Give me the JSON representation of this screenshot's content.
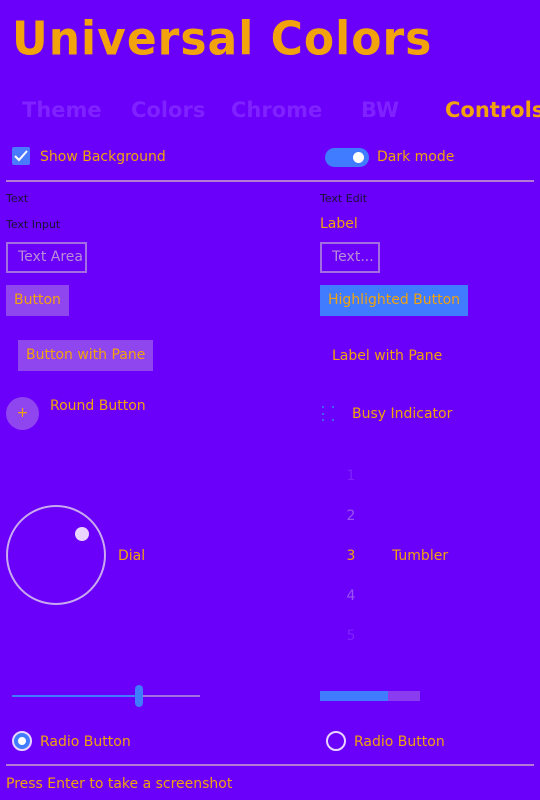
{
  "app": {
    "title": "Universal Colors"
  },
  "tabs": [
    {
      "label": "Theme",
      "active": false
    },
    {
      "label": "Colors",
      "active": false
    },
    {
      "label": "Chrome",
      "active": false
    },
    {
      "label": "BW",
      "active": false
    },
    {
      "label": "Controls",
      "active": true
    }
  ],
  "options": {
    "show_background": {
      "label": "Show Background",
      "checked": true
    },
    "dark_mode": {
      "label": "Dark mode",
      "on": true
    }
  },
  "controls": {
    "text_label": "Text",
    "text_edit_label": "Text Edit",
    "text_input_label": "Text Input",
    "label_label": "Label",
    "text_area_placeholder": "Text Area",
    "text_field_placeholder": "Text...",
    "button": "Button",
    "highlighted_button": "Highlighted Button",
    "button_with_pane": "Button with Pane",
    "label_with_pane": "Label with Pane",
    "round_button_symbol": "+",
    "round_button": "Round Button",
    "busy_indicator": "Busy Indicator",
    "dial": "Dial",
    "tumbler_label": "Tumbler",
    "tumbler_values": [
      "1",
      "2",
      "3",
      "4",
      "5"
    ],
    "tumbler_selected": "3",
    "slider_value": 0.67,
    "progress_value": 0.68,
    "radio_buttons": [
      {
        "label": "Radio Button",
        "checked": true
      },
      {
        "label": "Radio Button",
        "checked": false
      }
    ]
  },
  "status": {
    "text": "Press Enter to take a screenshot"
  },
  "colors": {
    "background": "#6a00f9",
    "accent": "#f2a20c",
    "highlight": "#3f7cff",
    "inactive_tab": "#7f22ff"
  }
}
